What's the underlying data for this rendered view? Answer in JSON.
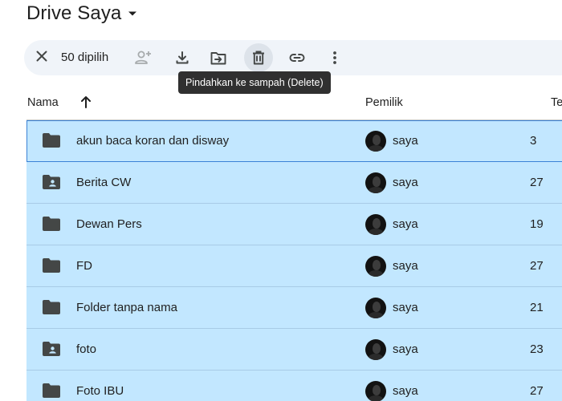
{
  "header": {
    "title": "Drive Saya",
    "title_icon": "caret-down-icon"
  },
  "toolbar": {
    "selected_count": "50 dipilih",
    "buttons": [
      {
        "icon": "close-icon"
      },
      {
        "icon": "share-person-add-icon"
      },
      {
        "icon": "download-icon"
      },
      {
        "icon": "move-to-folder-icon"
      },
      {
        "icon": "trash-icon"
      },
      {
        "icon": "link-icon"
      },
      {
        "icon": "more-vert-icon"
      }
    ],
    "tooltip": "Pindahkan ke sampah (Delete)"
  },
  "columns": {
    "name": "Nama",
    "owner": "Pemilik",
    "modified": "Te",
    "sort_icon": "arrow-up-icon"
  },
  "rows": [
    {
      "name": "akun baca koran dan disway",
      "type": "folder",
      "owner": "saya",
      "date": "3"
    },
    {
      "name": "Berita CW",
      "type": "shared-folder",
      "owner": "saya",
      "date": "27"
    },
    {
      "name": "Dewan Pers",
      "type": "folder",
      "owner": "saya",
      "date": "19"
    },
    {
      "name": "FD",
      "type": "folder",
      "owner": "saya",
      "date": "27"
    },
    {
      "name": "Folder tanpa nama",
      "type": "folder",
      "owner": "saya",
      "date": "21"
    },
    {
      "name": "foto",
      "type": "shared-folder",
      "owner": "saya",
      "date": "23"
    },
    {
      "name": "Foto IBU",
      "type": "folder",
      "owner": "saya",
      "date": "27"
    }
  ],
  "colors": {
    "selection": "#c2e7ff",
    "toolbar_bg": "#f0f4f9",
    "tooltip_bg": "#303030",
    "icon": "#444746"
  }
}
